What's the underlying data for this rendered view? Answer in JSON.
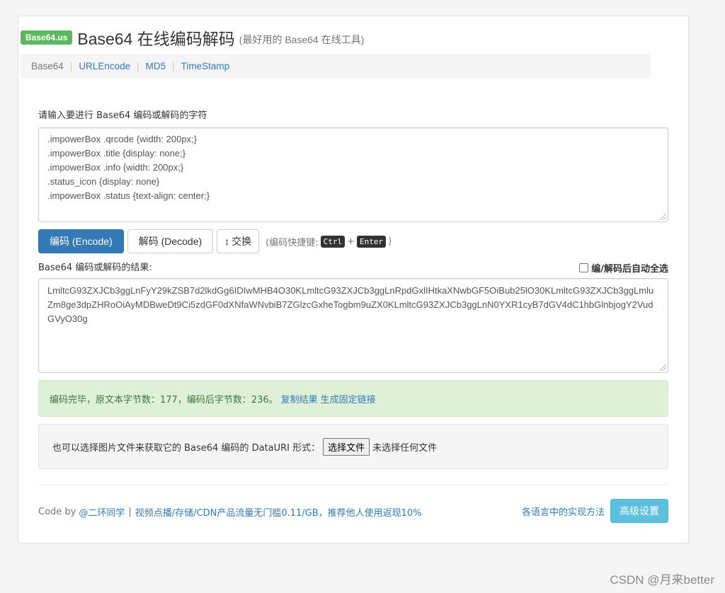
{
  "header": {
    "badge": "Base64.us",
    "title": "Base64 在线编码解码",
    "subtitle": "(最好用的 Base64 在线工具)"
  },
  "nav": {
    "items": [
      {
        "label": "Base64"
      },
      {
        "label": "URLEncode"
      },
      {
        "label": "MD5"
      },
      {
        "label": "TimeStamp"
      }
    ],
    "separator": "|"
  },
  "input": {
    "label": "请输入要进行 Base64 编码或解码的字符",
    "lines": [
      ".impowerBox .qrcode {width: 200px;}",
      ".impowerBox .title {display: none;}",
      ".impowerBox .info {width: 200px;}",
      ".status_icon {display: none}",
      ".impowerBox .status {text-align: center;}"
    ]
  },
  "actions": {
    "encode": "编码 (Encode)",
    "decode": "解码 (Decode)",
    "swap_icon": "↕",
    "swap": "交换",
    "shortcut_prefix": "(编码快捷键:",
    "key_ctrl": "Ctrl",
    "plus": "+",
    "key_enter": "Enter",
    "shortcut_suffix": ")"
  },
  "result": {
    "label": "Base64 编码或解码的结果:",
    "auto_select": "编/解码后自动全选",
    "text": "LmltcG93ZXJCb3ggLnFyY29kZSB7d2lkdGg6IDIwMHB4O30KLmltcG93ZXJCb3ggLnRpdGxlIHtkaXNwbGF5OiBub25lO30KLmltcG93ZXJCb3ggLmluZm8ge3dpZHRoOiAyMDBweDt9Ci5zdGF0dXNfaWNvbiB7ZGlzcGxheTogbm9uZX0KLmltcG93ZXJCb3ggLnN0YXR1cyB7dGV4dC1hbGlnbjogY2VudGVyO30g"
  },
  "status": {
    "message": "编码完毕，原文本字节数：177，编码后字节数：236。",
    "copy_link": "复制结果",
    "permalink": "生成固定链接"
  },
  "file": {
    "prompt": "也可以选择图片文件来获取它的 Base64 编码的 DataURI 形式：",
    "button": "选择文件",
    "no_file": "未选择任何文件"
  },
  "footer": {
    "code_by": "Code by",
    "author": "@二环同学",
    "sep": "|",
    "ad": "视频点播/存储/CDN产品流量无门槛0.11/GB，推荐他人使用返现10%",
    "impl_link": "各语言中的实现方法",
    "advanced": "高级设置"
  },
  "watermark": "CSDN @月来better",
  "colors": {
    "primary": "#337ab7",
    "success_badge": "#5cb85c",
    "info": "#5bc0de",
    "alert_bg": "#dff0d8"
  }
}
